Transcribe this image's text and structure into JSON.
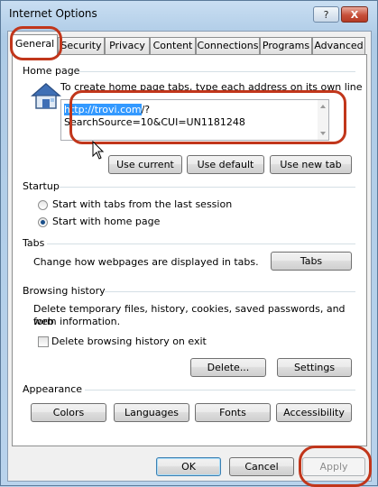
{
  "window": {
    "title": "Internet Options",
    "help_label": "?",
    "close_label": "X"
  },
  "tabs": [
    {
      "label": "General",
      "active": true
    },
    {
      "label": "Security"
    },
    {
      "label": "Privacy"
    },
    {
      "label": "Content"
    },
    {
      "label": "Connections"
    },
    {
      "label": "Programs"
    },
    {
      "label": "Advanced"
    }
  ],
  "home_page": {
    "label": "Home page",
    "instructions": "To create home page tabs, type each address on its own line.",
    "url_selected": "http://trovi.com",
    "url_rest": "/?SearchSource=10&CUI=UN1181248",
    "buttons": {
      "use_current": "Use current",
      "use_default": "Use default",
      "use_new_tab": "Use new tab"
    }
  },
  "startup": {
    "label": "Startup",
    "options": [
      {
        "label": "Start with tabs from the last session",
        "selected": false
      },
      {
        "label": "Start with home page",
        "selected": true
      }
    ]
  },
  "tabs_section": {
    "label": "Tabs",
    "description": "Change how webpages are displayed in tabs.",
    "button": "Tabs"
  },
  "browsing_history": {
    "label": "Browsing history",
    "description_line1": "Delete temporary files, history, cookies, saved passwords, and web",
    "description_line2": "form information.",
    "checkbox_label": "Delete browsing history on exit",
    "checkbox_checked": false,
    "delete_button": "Delete...",
    "settings_button": "Settings"
  },
  "appearance": {
    "label": "Appearance",
    "buttons": {
      "colors": "Colors",
      "languages": "Languages",
      "fonts": "Fonts",
      "accessibility": "Accessibility"
    }
  },
  "footer": {
    "ok": "OK",
    "cancel": "Cancel",
    "apply": "Apply"
  },
  "colors": {
    "annotation_ring": "#c1361b",
    "selection": "#3399ff"
  }
}
